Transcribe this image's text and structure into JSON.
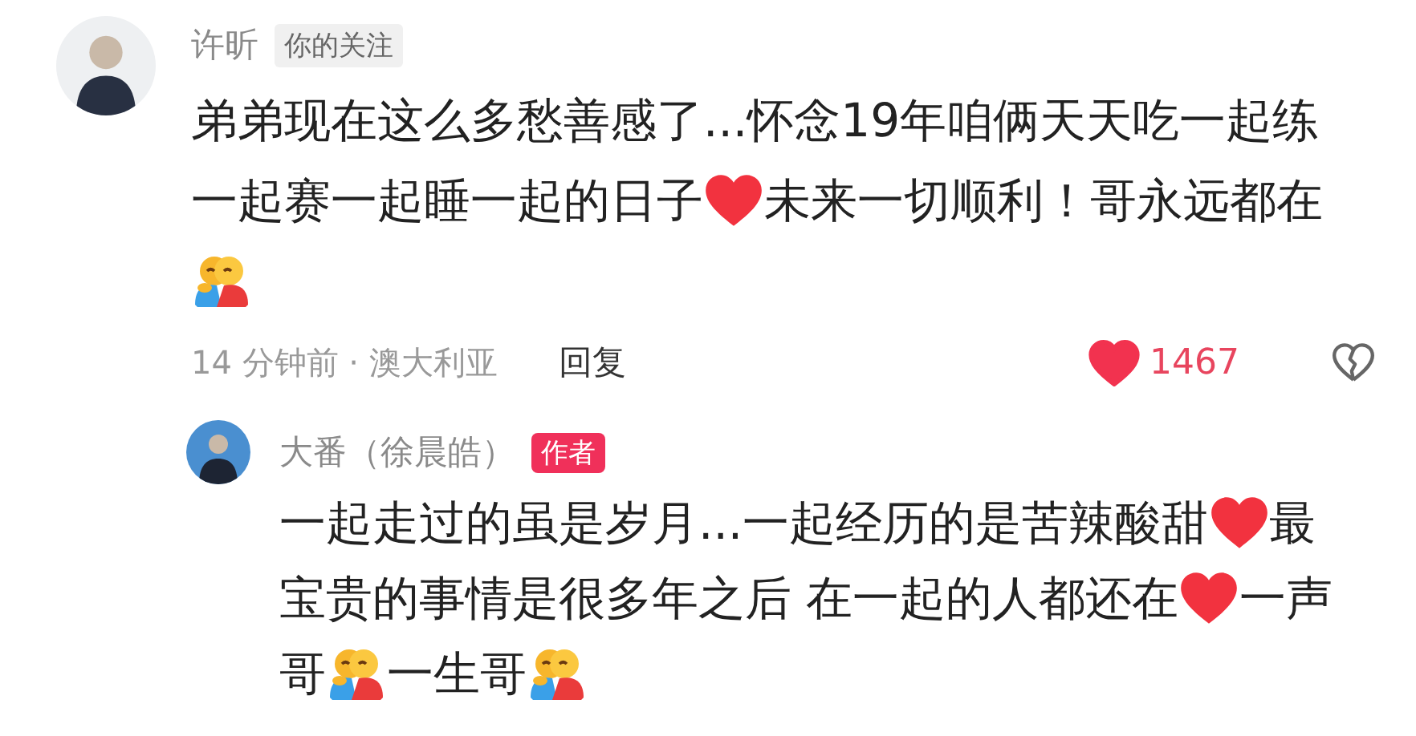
{
  "comment": {
    "author": "许昕",
    "badge": "你的关注",
    "lines": [
      [
        {
          "kind": "text",
          "text": "弟弟现在这么多愁善感了...怀念19年咱俩天天吃一起练"
        }
      ],
      [
        {
          "kind": "text",
          "text": "一起赛一起睡一起的日子"
        },
        {
          "kind": "heart"
        },
        {
          "kind": "text",
          "text": "未来一切顺利！哥永远都在"
        }
      ],
      [
        {
          "kind": "hug"
        }
      ]
    ],
    "meta": "14 分钟前 · 澳大利亚",
    "reply_label": "回复",
    "liked": true,
    "likes": "1467",
    "reply": {
      "author": "大番（徐晨皓）",
      "badge": "作者",
      "lines": [
        [
          {
            "kind": "text",
            "text": "一起走过的虽是岁月...一起经历的是苦辣酸甜"
          },
          {
            "kind": "heart"
          },
          {
            "kind": "text",
            "text": "最"
          }
        ],
        [
          {
            "kind": "text",
            "text": "宝贵的事情是很多年之后 在一起的人都还在"
          },
          {
            "kind": "heart"
          },
          {
            "kind": "text",
            "text": "一声"
          }
        ],
        [
          {
            "kind": "text",
            "text": "哥"
          },
          {
            "kind": "hug"
          },
          {
            "kind": "text",
            "text": "一生哥"
          },
          {
            "kind": "hug"
          }
        ]
      ]
    }
  }
}
